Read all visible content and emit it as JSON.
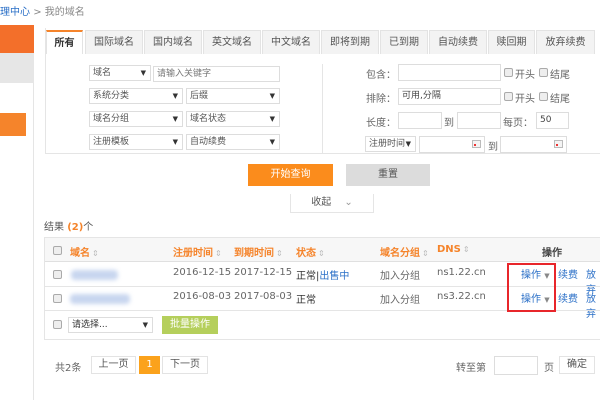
{
  "breadcrumb": {
    "parent": "理中心",
    "separator": ">",
    "current": "我的域名"
  },
  "tabs": [
    "所有",
    "国际域名",
    "国内域名",
    "英文域名",
    "中文域名",
    "即将到期",
    "已到期",
    "自动续费",
    "赎回期",
    "放弃续费"
  ],
  "filters": {
    "field_select": "域名",
    "keyword_placeholder": "请输入关键字",
    "system_category": "系统分类",
    "suffix": "后缀",
    "domain_group": "域名分组",
    "domain_status": "域名状态",
    "template": "注册模板",
    "auto_renew": "自动续费",
    "contains_label": "包含：",
    "exclude_label": "排除：",
    "exclude_value": "可用,分隔",
    "starts_label": "开头",
    "ends_label": "结尾",
    "length_label": "长度：",
    "to": "到",
    "per_page_label": "每页：",
    "per_page": "50",
    "date_type": "注册时间"
  },
  "buttons": {
    "search": "开始查询",
    "reset": "重置",
    "collapse": "收起",
    "batch": "批量操作",
    "confirm": "确定"
  },
  "results": {
    "label": "结果",
    "count": "(2)",
    "unit": "个"
  },
  "table": {
    "headers": [
      "域名",
      "注册时间",
      "到期时间",
      "状态",
      "域名分组",
      "DNS",
      "操作"
    ],
    "rows": [
      {
        "reg": "2016-12-15",
        "exp": "2017-12-15",
        "status": "正常",
        "status_extra": "出售中",
        "group": "加入分组",
        "dns": "ns1.22.cn",
        "op": "操作",
        "renew": "续费",
        "abandon": "放弃"
      },
      {
        "reg": "2016-08-03",
        "exp": "2017-08-03",
        "status": "正常",
        "status_extra": "",
        "group": "加入分组",
        "dns": "ns3.22.cn",
        "op": "操作",
        "renew": "续费",
        "abandon": "放弃"
      }
    ],
    "batch_select": "请选择..."
  },
  "pagination": {
    "total": "共2条",
    "prev": "上一页",
    "current": "1",
    "next": "下一页",
    "goto": "转至第",
    "page": "页"
  },
  "colors": {
    "accent": "#f5842b",
    "link": "#2a6fc7",
    "batch": "#b5cf5c",
    "highlight": "#e8262b"
  }
}
